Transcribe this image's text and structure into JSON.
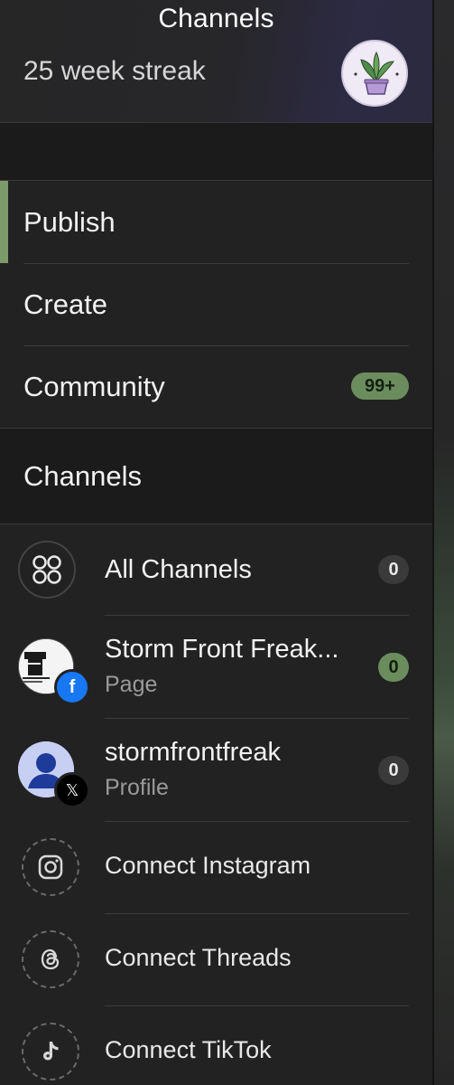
{
  "header": {
    "title": "Channels",
    "streak": "25 week streak",
    "avatar_icon": "potted-plant-avatar"
  },
  "nav": {
    "items": [
      {
        "label": "Publish",
        "active": true
      },
      {
        "label": "Create"
      },
      {
        "label": "Community",
        "badge": "99+"
      }
    ]
  },
  "channels": {
    "heading": "Channels",
    "all": {
      "label": "All Channels",
      "count": "0",
      "icon": "grid-circles-icon"
    },
    "accounts": [
      {
        "name": "Storm Front Freak...",
        "type": "Page",
        "count": "0",
        "network": "facebook",
        "network_glyph": "f"
      },
      {
        "name": "stormfrontfreak",
        "type": "Profile",
        "count": "0",
        "network": "x",
        "network_glyph": "𝕏"
      }
    ],
    "connect": [
      {
        "label": "Connect Instagram",
        "icon": "instagram-icon"
      },
      {
        "label": "Connect Threads",
        "icon": "threads-icon"
      },
      {
        "label": "Connect TikTok",
        "icon": "tiktok-icon"
      }
    ]
  },
  "colors": {
    "accent_green": "#7c9a6a",
    "badge_green": "#6b8d5e",
    "facebook_blue": "#1877f2",
    "background": "#222222"
  }
}
